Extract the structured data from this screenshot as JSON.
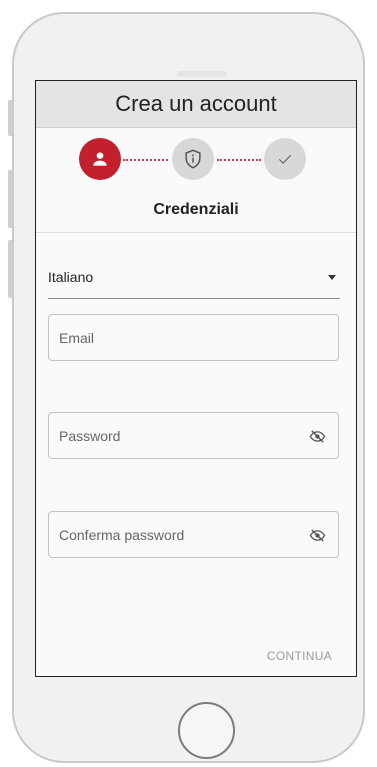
{
  "app_bar": {
    "title": "Crea un account"
  },
  "stepper": {
    "steps": [
      {
        "icon": "person-icon",
        "state": "active"
      },
      {
        "icon": "shield-info-icon",
        "state": "inactive"
      },
      {
        "icon": "check-icon",
        "state": "inactive"
      }
    ],
    "current_title": "Credenziali"
  },
  "language_select": {
    "value": "Italiano"
  },
  "form": {
    "email": {
      "placeholder": "Email",
      "value": ""
    },
    "password": {
      "placeholder": "Password",
      "value": ""
    },
    "confirm_password": {
      "placeholder": "Conferma password",
      "value": ""
    }
  },
  "actions": {
    "continue_label": "CONTINUA"
  },
  "colors": {
    "accent": "#c2202c",
    "app_bar_bg": "#e4e4e4",
    "inactive_step": "#d8d8d8"
  }
}
